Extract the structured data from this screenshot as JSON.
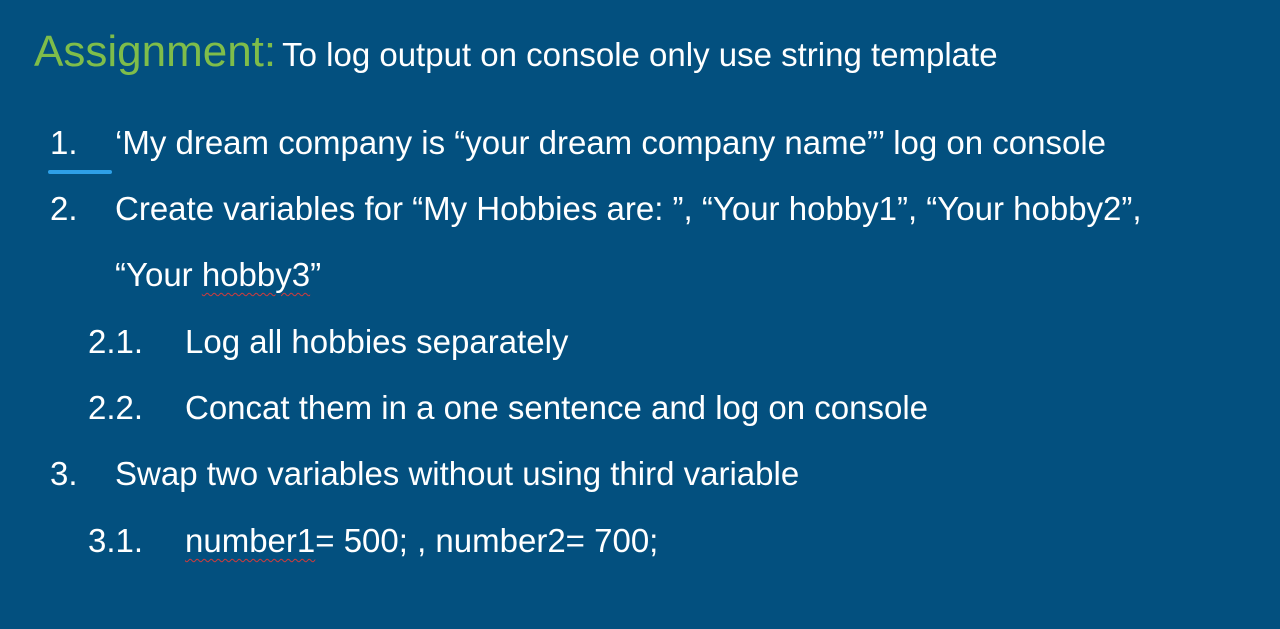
{
  "slide": {
    "title_label": "Assignment:",
    "title_text": "To log output on console only use string template",
    "items": [
      {
        "number": "1.",
        "text": "‘My dream company is “your dream company name”’ log on console"
      },
      {
        "number": "2.",
        "text": "Create variables for “My Hobbies are: ”, “Your hobby1”, “Your hobby2”,",
        "continuation_prefix": "“Your ",
        "continuation_flagged": "hobby3",
        "continuation_suffix": "”"
      },
      {
        "number": "2.1.",
        "text": "Log all hobbies separately"
      },
      {
        "number": "2.2.",
        "text": "Concat them in a one sentence and log on console"
      },
      {
        "number": "3.",
        "text": "Swap two variables without using third variable"
      },
      {
        "number": "3.1.",
        "text_flagged": "number1",
        "text_rest": "= 500; , number2= 700;"
      }
    ]
  },
  "colors": {
    "background": "#03507f",
    "title_label": "#7fbd4a",
    "text": "#ffffff",
    "spellcheck_underline": "#d23b3b",
    "cursor_indicator": "#2ea0e8"
  }
}
